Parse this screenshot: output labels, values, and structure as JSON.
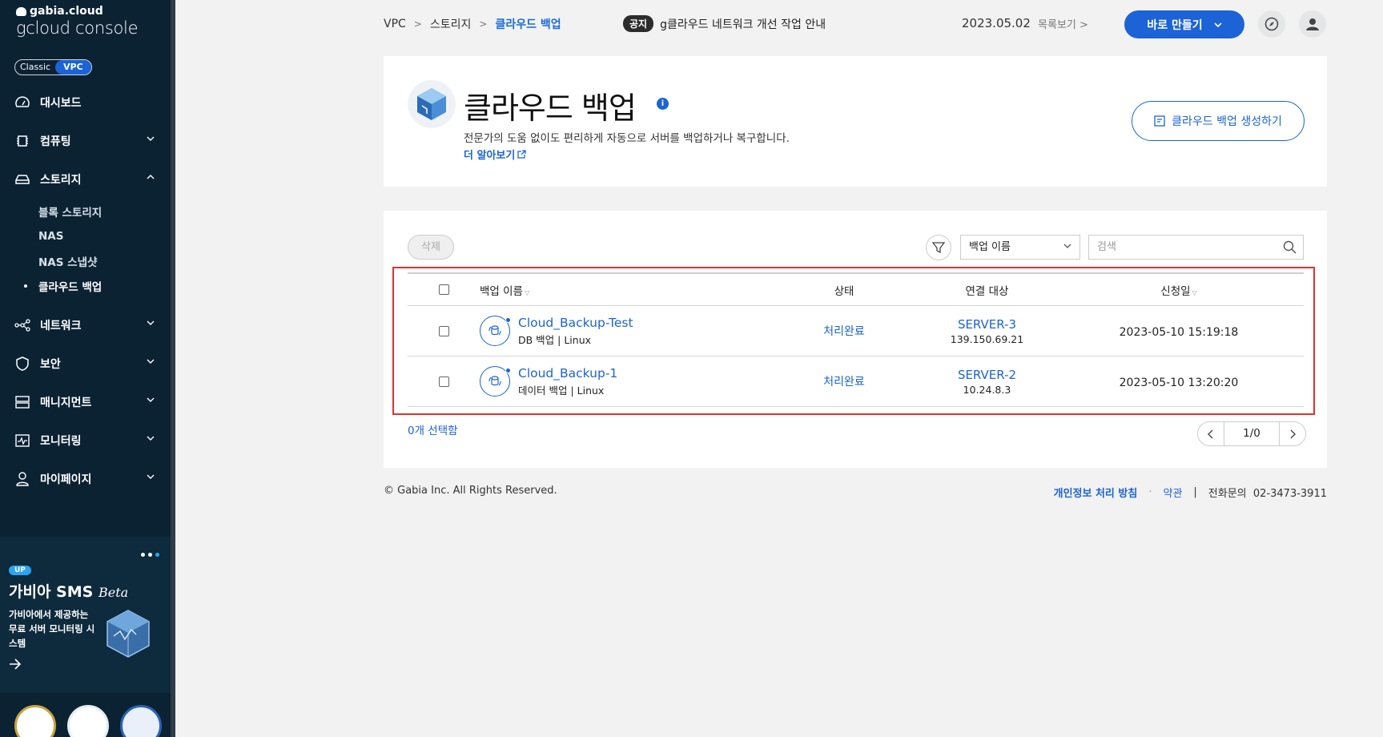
{
  "sidebar": {
    "brand_small": "gabia.cloud",
    "brand_big": "gcloud console",
    "mode": {
      "classic": "Classic",
      "vpc": "VPC"
    },
    "items": [
      {
        "label": "대시보드",
        "icon": "dashboard-icon"
      },
      {
        "label": "컴퓨팅",
        "icon": "chip-icon"
      },
      {
        "label": "스토리지",
        "icon": "storage-icon"
      },
      {
        "label": "네트워크",
        "icon": "network-icon"
      },
      {
        "label": "보안",
        "icon": "shield-icon"
      },
      {
        "label": "매니지먼트",
        "icon": "server-icon"
      },
      {
        "label": "모니터링",
        "icon": "monitor-icon"
      },
      {
        "label": "마이페이지",
        "icon": "user-icon"
      }
    ],
    "storage_sub": [
      "블록 스토리지",
      "NAS",
      "NAS 스냅샷",
      "클라우드 백업"
    ],
    "promo": {
      "badge": "UP",
      "title": "가비아 SMS",
      "title_suffix": "Beta",
      "desc": "가비아에서 제공하는 무료 서버 모니터링 시스템"
    }
  },
  "topbar": {
    "breadcrumb": [
      "VPC",
      "스토리지",
      "클라우드 백업"
    ],
    "notice_tag": "공지",
    "notice_text": "g클라우드 네트워크 개선 작업 안내",
    "notice_date": "2023.05.02",
    "notice_list": "목록보기",
    "quick_create": "바로 만들기"
  },
  "header": {
    "title": "클라우드 백업",
    "desc": "전문가의 도움 없이도 편리하게 자동으로 서버를 백업하거나 복구합니다.",
    "more": "더 알아보기",
    "create_button": "클라우드 백업 생성하기"
  },
  "toolbar": {
    "delete": "삭제",
    "select_value": "백업 이름",
    "search_placeholder": "검색"
  },
  "table": {
    "columns": {
      "name": "백업 이름",
      "status": "상태",
      "target": "연결 대상",
      "date": "신청일"
    },
    "rows": [
      {
        "name": "Cloud_Backup-Test",
        "sub": "DB 백업 | Linux",
        "status": "처리완료",
        "server": "SERVER-3",
        "ip": "139.150.69.21",
        "date": "2023-05-10 15:19:18"
      },
      {
        "name": "Cloud_Backup-1",
        "sub": "데이터 백업 | Linux",
        "status": "처리완료",
        "server": "SERVER-2",
        "ip": "10.24.8.3",
        "date": "2023-05-10 13:20:20"
      }
    ],
    "selected_count": "0개 선택함",
    "page": "1/0"
  },
  "footer": {
    "copyright": "© Gabia Inc. All Rights Reserved.",
    "policy": "개인정보 처리 방침",
    "dot": "·",
    "terms": "약관",
    "divider": "|",
    "phone_label": "전화문의",
    "phone": "02-3473-3911"
  },
  "colors": {
    "accent": "#1b63d6",
    "sidebar": "#0b2233",
    "highlight": "#e03131"
  }
}
